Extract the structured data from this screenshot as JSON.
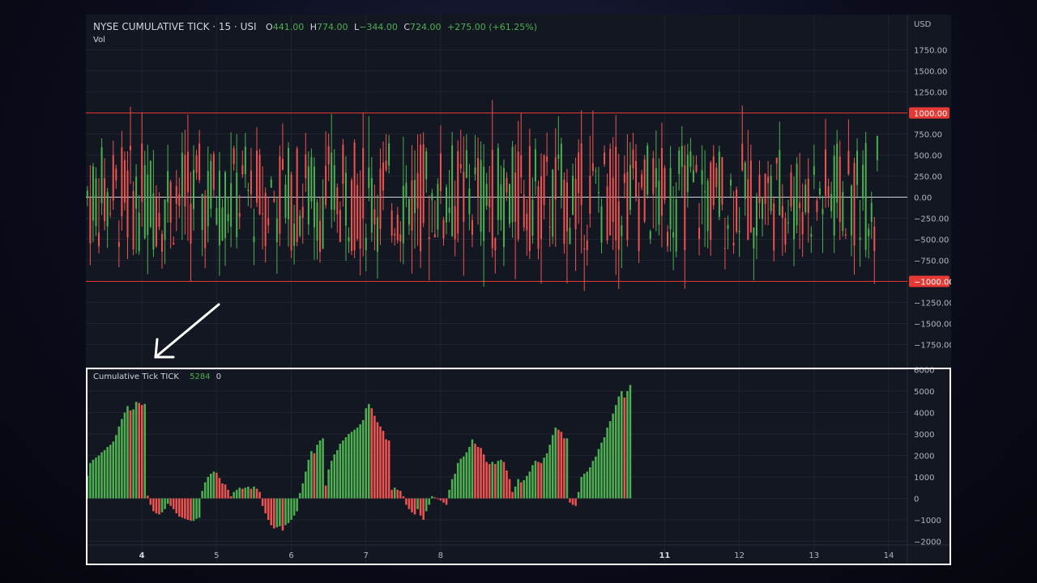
{
  "header": {
    "symbol_title": "NYSE CUMULATIVE TICK · 15 · USI",
    "ohlc": [
      {
        "k": "O",
        "v": "441.00"
      },
      {
        "k": "H",
        "v": "774.00"
      },
      {
        "k": "L",
        "v": "−344.00"
      },
      {
        "k": "C",
        "v": "724.00"
      }
    ],
    "change": "+275.00 (+61.25%)",
    "vol_label": "Vol",
    "currency": "USD"
  },
  "indicator": {
    "title": "Cumulative Tick TICK",
    "value": "5284",
    "zero": "0"
  },
  "colors": {
    "up": "#4caf50",
    "down": "#ef5350",
    "background": "#131722",
    "grid": "#1f2430",
    "level_line": "#e53935",
    "zero_line": "#d1d4dc",
    "text": "#b2b5be"
  },
  "chart_data": [
    {
      "type": "candlestick",
      "title": "NYSE CUMULATIVE TICK · 15 · USI",
      "ylim": [
        -2000,
        2000
      ],
      "y_ticks": [
        1750,
        1500,
        1250,
        1000,
        750,
        500,
        250,
        0,
        -250,
        -500,
        -750,
        -1000,
        -1250,
        -1500,
        -1750
      ],
      "y_tick_labels": [
        "1750.00",
        "1500.00",
        "1250.00",
        "1000.00",
        "750.00",
        "500.00",
        "250.00",
        "0.00",
        "−250.00",
        "−500.00",
        "−750.00",
        "−1000.00",
        "−1250.00",
        "−1500.00",
        "−1750.00"
      ],
      "level_lines": [
        1000,
        -1000
      ],
      "level_labels": [
        "1000.00",
        "−1000.00"
      ],
      "zero_line": 0,
      "x_range": [
        3.25,
        14.25
      ],
      "x_ticks": [
        4,
        5,
        6,
        7,
        8,
        11,
        12,
        13,
        14
      ],
      "x_tick_labels": [
        "4",
        "5",
        "6",
        "7",
        "8",
        "11",
        "12",
        "13",
        "14"
      ],
      "bold_x_ticks": [
        "4",
        "11"
      ],
      "candles_per_day": 26,
      "first_candle_x": 3.27,
      "last_ohlc": {
        "open": 441,
        "high": 774,
        "low": -344,
        "close": 724
      }
    },
    {
      "type": "bar",
      "title": "Cumulative Tick TICK",
      "ylim": [
        -2000,
        6000
      ],
      "y_ticks": [
        6000,
        5000,
        4000,
        3000,
        2000,
        1000,
        0,
        -1000,
        -2000
      ],
      "y_tick_labels": [
        "6000",
        "5000",
        "4000",
        "3000",
        "2000",
        "1000",
        "0",
        "−1000",
        "−2000"
      ],
      "x_start": 3.27,
      "bars_per_day": 26,
      "values": [
        1050,
        1650,
        1800,
        1900,
        2000,
        2150,
        2250,
        2400,
        2500,
        2650,
        2950,
        3350,
        3700,
        4000,
        4300,
        4100,
        4150,
        4500,
        4450,
        4350,
        4400,
        130,
        -300,
        -600,
        -700,
        -750,
        -650,
        -500,
        -250,
        -350,
        -500,
        -700,
        -850,
        -900,
        -950,
        -1000,
        -1050,
        -1050,
        -950,
        -900,
        350,
        750,
        1000,
        1150,
        1250,
        1200,
        950,
        700,
        650,
        400,
        100,
        300,
        400,
        500,
        450,
        500,
        550,
        450,
        550,
        450,
        300,
        -350,
        -700,
        -1000,
        -1250,
        -1400,
        -1350,
        -1300,
        -1500,
        -1250,
        -1150,
        -1000,
        -800,
        -600,
        250,
        700,
        1250,
        1800,
        2200,
        2100,
        2500,
        2700,
        2800,
        600,
        1350,
        1750,
        2050,
        2250,
        2550,
        2700,
        2850,
        3000,
        3100,
        3200,
        3300,
        3450,
        3650,
        4200,
        4400,
        4200,
        3850,
        3550,
        3350,
        3150,
        2750,
        2700,
        400,
        500,
        400,
        350,
        100,
        -300,
        -500,
        -650,
        -750,
        -500,
        -800,
        -1000,
        -600,
        -300,
        100,
        50,
        0,
        -100,
        -200,
        -300,
        400,
        900,
        1150,
        1650,
        1850,
        1950,
        2150,
        2400,
        2750,
        2550,
        2400,
        2350,
        2050,
        1700,
        1600,
        1700,
        1600,
        1750,
        1800,
        1700,
        1300,
        900,
        300,
        550,
        900,
        750,
        850,
        1050,
        1250,
        1550,
        1750,
        1700,
        1650,
        1900,
        2100,
        2500,
        2950,
        3300,
        3200,
        3100,
        2800,
        2800,
        -200,
        -300,
        -350,
        300,
        1000,
        1150,
        1250,
        1450,
        1750,
        1950,
        2300,
        2600,
        2850,
        3300,
        3600,
        3950,
        4350,
        4750,
        5000,
        4700,
        5000,
        5284
      ]
    }
  ]
}
